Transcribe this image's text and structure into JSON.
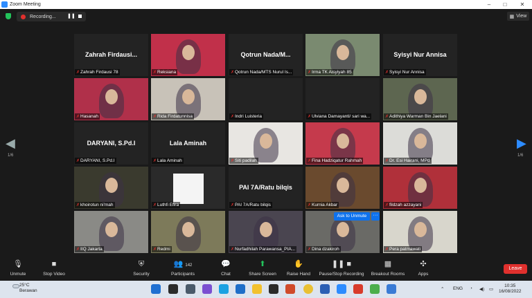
{
  "window": {
    "title": "Zoom Meeting",
    "minimize": "–",
    "maximize": "□",
    "close": "✕"
  },
  "recording": {
    "label": "Recording...",
    "pause": "❚❚",
    "stop": ""
  },
  "view_button": {
    "label": "View",
    "icon": "grid-icon"
  },
  "navigation": {
    "prev_page": "1/6",
    "next_page": "1/6"
  },
  "participants": [
    {
      "big": "Zahrah Firdausi...",
      "label": "Zahrah Firdausi 78",
      "video": false
    },
    {
      "big": "",
      "label": "Reksiana",
      "video": true,
      "bg": "#c1304a"
    },
    {
      "big": "Qotrun Nada/M...",
      "label": "Qotrun Nada/MTS Nurul Is...",
      "video": false
    },
    {
      "big": "",
      "label": "Irma TK Aisyiyah 85",
      "video": true,
      "bg": "#7a8a70"
    },
    {
      "big": "Syisyi Nur Annisa",
      "label": "Syisyi Nur Annisa",
      "video": false
    },
    {
      "big": "",
      "label": "Hasanah",
      "video": true,
      "bg": "#b0304a"
    },
    {
      "big": "",
      "label": "Rida Firdatunnisa",
      "video": true,
      "bg": "#c8c2b8"
    },
    {
      "big": "",
      "label": "Indri Luisteria",
      "video": false
    },
    {
      "big": "",
      "label": "Ulviana Damayanti/ sari wa...",
      "video": false
    },
    {
      "big": "",
      "label": "Adithiya Warman Bin Jaelani",
      "video": true,
      "bg": "#5d6650"
    },
    {
      "big": "DARYANI, S.Pd.I",
      "label": "DARYANI, S.Pd.I",
      "video": false
    },
    {
      "big": "Lala Aminah",
      "label": "Lala Aminah",
      "video": false
    },
    {
      "big": "",
      "label": "Siti padilah",
      "video": true,
      "bg": "#e8e6e2"
    },
    {
      "big": "",
      "label": "Fina Hadziqatur Rahmah",
      "video": true,
      "bg": "#c53a4c"
    },
    {
      "big": "",
      "label": "Dr. Esi Hairani, MPd",
      "video": true,
      "bg": "#dcdcd8"
    },
    {
      "big": "",
      "label": "khoirotun ni'mah",
      "video": true,
      "bg": "#3a3a2e"
    },
    {
      "big": "",
      "label": "Luthfi Efira",
      "video": true,
      "bg": "#2a2a2a"
    },
    {
      "big": "PAI 7A/Ratu bilqis",
      "label": "PAI 7A/Ratu bilqis",
      "video": false
    },
    {
      "big": "",
      "label": "Kurnia Akbar",
      "video": true,
      "bg": "#6a4a2e"
    },
    {
      "big": "",
      "label": "fildzah azzayani",
      "video": true,
      "bg": "#b0303a"
    },
    {
      "big": "",
      "label": "IIQ Jakarta",
      "video": true,
      "bg": "#8a8a86"
    },
    {
      "big": "",
      "label": "Redmi",
      "video": true,
      "bg": "#7d7a5a"
    },
    {
      "big": "",
      "label": "Nurfadhilah Parawansa_PIA...",
      "video": true,
      "bg": "#4a4550"
    },
    {
      "big": "",
      "label": "Dina dzakiroh",
      "video": true,
      "bg": "#6a6a66"
    },
    {
      "big": "",
      "label": "Pera patmawati",
      "video": true,
      "bg": "#d8d6cc"
    }
  ],
  "ask_to_unmute": {
    "label": "Ask to Unmute",
    "more": "···"
  },
  "toolbar": {
    "unmute": "Unmute",
    "stop_video": "Stop Video",
    "security": "Security",
    "participants": "Participants",
    "participants_count": "142",
    "chat": "Chat",
    "share_screen": "Share Screen",
    "raise_hand": "Raise Hand",
    "pause_stop_recording": "Pause/Stop Recording",
    "breakout_rooms": "Breakout Rooms",
    "apps": "Apps",
    "leave": "Leave"
  },
  "taskbar": {
    "temperature": "25°C",
    "weather": "Berawan",
    "language": "ENG",
    "time": "10:35",
    "date": "16/08/2022"
  },
  "colors": {
    "accent": "#2d8cff",
    "recording_red": "#e0302d",
    "active_speaker": "#d7e354",
    "share_green": "#23c35b"
  }
}
